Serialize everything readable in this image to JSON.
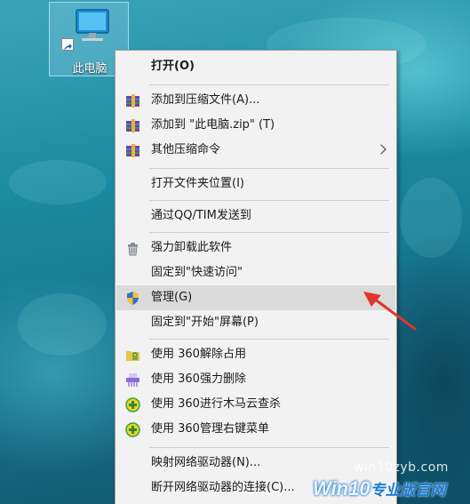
{
  "desktop": {
    "icon_label": "此电脑"
  },
  "menu": {
    "items": [
      {
        "label": "打开(O)"
      },
      {
        "label": "添加到压缩文件(A)...",
        "icon": "winrar-archive-icon"
      },
      {
        "label": "添加到 \"此电脑.zip\" (T)",
        "icon": "winrar-archive-icon"
      },
      {
        "label": "其他压缩命令",
        "icon": "winrar-archive-icon"
      },
      {
        "label": "打开文件夹位置(I)"
      },
      {
        "label": "通过QQ/TIM发送到"
      },
      {
        "label": "强力卸载此软件",
        "icon": "trash-icon"
      },
      {
        "label": "固定到\"快速访问\""
      },
      {
        "label": "管理(G)",
        "icon": "shield-icon"
      },
      {
        "label": "固定到\"开始\"屏幕(P)"
      },
      {
        "label": "使用 360解除占用",
        "icon": "folder-lock-icon"
      },
      {
        "label": "使用 360强力删除",
        "icon": "shredder-icon"
      },
      {
        "label": "使用 360进行木马云查杀",
        "icon": "360-plus-icon"
      },
      {
        "label": "使用 360管理右键菜单",
        "icon": "360-plus-icon"
      },
      {
        "label": "映射网络驱动器(N)..."
      },
      {
        "label": "断开网络驱动器的连接(C)..."
      }
    ],
    "highlighted": "管理(G)"
  },
  "watermark": {
    "site": "win10zyb.com",
    "brand": "Win10",
    "brand_sub": "专业版官网"
  },
  "colors": {
    "annotation_arrow": "#e0362a",
    "menu_background": "#f2f2f2",
    "menu_highlight": "#dadada"
  }
}
